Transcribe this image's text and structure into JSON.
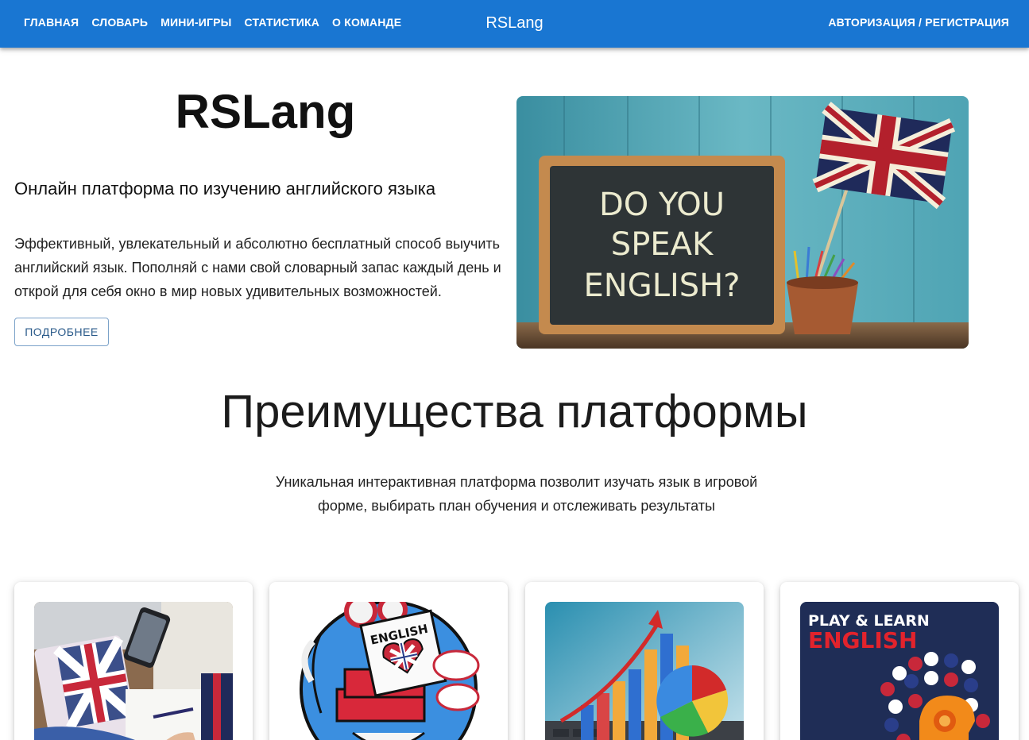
{
  "header": {
    "nav": [
      "Главная",
      "Словарь",
      "Мини-игры",
      "Статистика",
      "О команде"
    ],
    "brand": "RSLang",
    "auth": "Авторизация / Регистрация",
    "color": "#1976d2"
  },
  "hero": {
    "title": "RSLang",
    "subtitle": "Онлайн платформа по изучению английского языка",
    "text": "Эффективный, увлекательный и абсолютно бесплатный способ выучить английский язык. Пополняй с нами свой словарный запас каждый день и открой для себя окно в мир новых удивительных возможностей.",
    "button": "Подробнее",
    "image_chalkboard_text": [
      "DO YOU",
      "SPEAK",
      "ENGLISH?"
    ]
  },
  "advantages": {
    "title": "Преимущества платформы",
    "text": "Уникальная интерактивная платформа позволит изучать язык в игровой форме, выбирать план обучения и отслеживать результаты"
  },
  "cards": [
    {
      "image": "notebook-with-union-jack-photo"
    },
    {
      "image": "english-books-and-tea-illustration",
      "book_label": "ENGLISH"
    },
    {
      "image": "3d-bar-chart-photo"
    },
    {
      "image": "play-and-learn-english-poster",
      "poster_line1": "PLAY & LEARN",
      "poster_line2": "ENGLISH"
    }
  ]
}
